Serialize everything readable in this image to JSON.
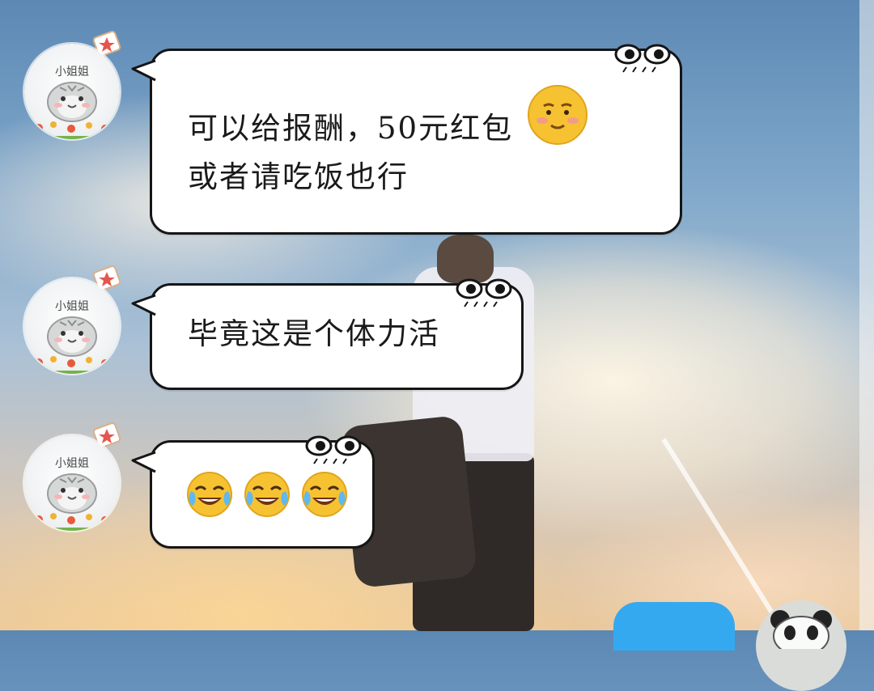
{
  "chat": {
    "contact": "小姐姐",
    "messages": [
      {
        "line1": "可以给报酬，50元红包",
        "line2": "或者请吃饭也行",
        "emoji": "shy-smile"
      },
      {
        "line1": "毕竟这是个体力活"
      },
      {
        "emoji_text": "😂😂😂",
        "emoji": "tears-of-joy"
      }
    ]
  },
  "colors": {
    "bubble_fill": "#ffffff",
    "bubble_border": "#151515",
    "outgoing_bubble": "#35a9ef"
  }
}
